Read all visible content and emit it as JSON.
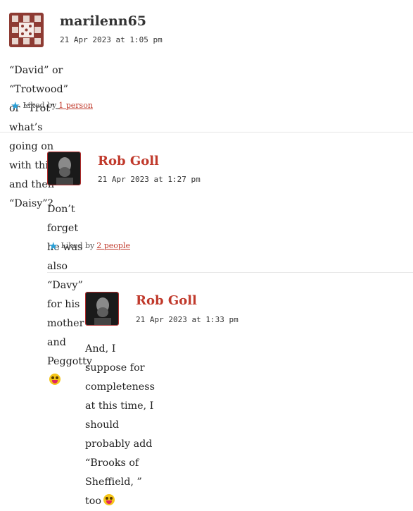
{
  "colors": {
    "author_link": "#c0392b",
    "like_star": "#2a9fd6",
    "divider": "#e6e6e6"
  },
  "comments": [
    {
      "author": "marilenn65",
      "date": "21 Apr 2023 at 1:05 pm",
      "text": "“David” or “Trotwood” or “Trot”–what’s going on with this, and then “Daisy”?",
      "likes_prefix": "Liked by",
      "likes_link": "1 person",
      "avatar_icon": "identicon-avatar"
    },
    {
      "author": "Rob Goll",
      "date": "21 Apr 2023 at 1:27 pm",
      "text": "Don’t forget he was also “Davy” for his mother and Peggotty",
      "emoji": "tongue-out-emoji",
      "likes_prefix": "Liked by",
      "likes_link": "2 people",
      "avatar_icon": "portrait-avatar"
    },
    {
      "author": "Rob Goll",
      "date": "21 Apr 2023 at 1:33 pm",
      "text_line1": "And, I suppose for completeness at this time, I should probably add",
      "text_line2": "“Brooks of Sheffield, ” too",
      "emoji": "tongue-out-emoji",
      "avatar_icon": "portrait-avatar"
    }
  ]
}
